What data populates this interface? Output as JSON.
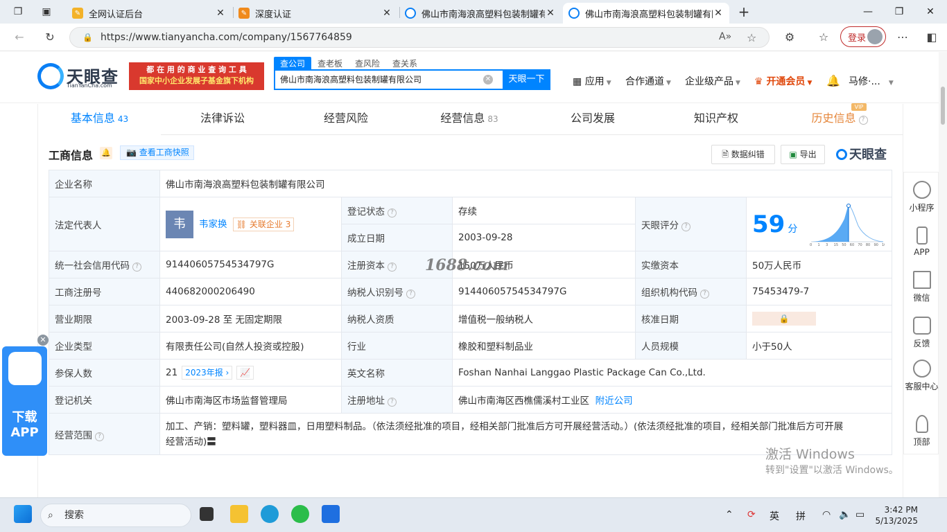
{
  "browser": {
    "tabs": [
      {
        "title": "全网认证后台",
        "active": false
      },
      {
        "title": "深度认证",
        "active": false
      },
      {
        "title": "佛山市南海浪高塑料包装制罐有限",
        "active": false
      },
      {
        "title": "佛山市南海浪高塑料包装制罐有限",
        "active": true
      }
    ],
    "url": "https://www.tianyancha.com/company/1567764859",
    "login_label": "登录"
  },
  "header": {
    "logo_text": "天眼查",
    "logo_sub": "TianYanCha.com",
    "ad_line1": "都 在 用 的 商 业 查 询 工 具",
    "ad_line2": "国家中小企业发展子基金旗下机构",
    "search_tabs": [
      "查公司",
      "查老板",
      "查风险",
      "查关系"
    ],
    "search_value": "佛山市南海浪高塑料包装制罐有限公司",
    "search_button": "天眼一下",
    "nav": [
      {
        "label": "应用"
      },
      {
        "label": "合作通道"
      },
      {
        "label": "企业级产品"
      },
      {
        "label": "开通会员"
      }
    ],
    "user_name": "马修·..."
  },
  "nav_tabs": [
    {
      "label": "基本信息",
      "count": "43"
    },
    {
      "label": "法律诉讼",
      "count": ""
    },
    {
      "label": "经营风险",
      "count": ""
    },
    {
      "label": "经营信息",
      "count": "83"
    },
    {
      "label": "公司发展",
      "count": ""
    },
    {
      "label": "知识产权",
      "count": ""
    },
    {
      "label": "历史信息",
      "count": "",
      "badge": "VIP"
    }
  ],
  "section": {
    "title": "工商信息",
    "snapshot_label": "查看工商快照",
    "correction_label": "数据纠错",
    "export_label": "导出",
    "brand": "天眼查"
  },
  "info": {
    "company_name_label": "企业名称",
    "company_name": "佛山市南海浪高塑料包装制罐有限公司",
    "legal_rep_label": "法定代表人",
    "legal_rep_avatar": "韦",
    "legal_rep": "韦家换",
    "related_label": "关联企业",
    "related_count": "3",
    "reg_status_label": "登记状态",
    "reg_status": "存续",
    "founded_label": "成立日期",
    "founded": "2003-09-28",
    "score_label": "天眼评分",
    "score": "59",
    "score_unit": "分",
    "score_axis": [
      "0",
      "1",
      "3",
      "15",
      "50",
      "60",
      "70",
      "80",
      "90",
      "100"
    ],
    "credit_code_label": "统一社会信用代码",
    "credit_code": "91440605754534797G",
    "reg_capital_label": "注册资本",
    "reg_capital": "150万人民币",
    "paid_capital_label": "实缴资本",
    "paid_capital": "50万人民币",
    "reg_no_label": "工商注册号",
    "reg_no": "440682000206490",
    "taxpayer_id_label": "纳税人识别号",
    "taxpayer_id": "91440605754534797G",
    "org_code_label": "组织机构代码",
    "org_code": "75453479-7",
    "term_label": "营业期限",
    "term": "2003-09-28 至 无固定期限",
    "taxpayer_qual_label": "纳税人资质",
    "taxpayer_qual": "增值税一般纳税人",
    "approval_date_label": "核准日期",
    "company_type_label": "企业类型",
    "company_type": "有限责任公司(自然人投资或控股)",
    "industry_label": "行业",
    "industry": "橡胶和塑料制品业",
    "staff_size_label": "人员规模",
    "staff_size": "小于50人",
    "insured_label": "参保人数",
    "insured": "21",
    "insured_year": "2023年报",
    "english_name_label": "英文名称",
    "english_name": "Foshan Nanhai Langgao Plastic Package Can Co.,Ltd.",
    "authority_label": "登记机关",
    "authority": "佛山市南海区市场监督管理局",
    "address_label": "注册地址",
    "address": "佛山市南海区西樵儒溪村工业区",
    "nearby_label": "附近公司",
    "scope_label": "经营范围",
    "scope_line1": "加工、产销：塑料罐，塑料器皿，日用塑料制品。（依法须经批准的项目，经相关部门批准后方可开展经营活动。）(依法须经批准的项目，经相关部门批准后方可开展",
    "scope_line2": "经营活动)"
  },
  "watermark": "1688.com",
  "right_sidebar": [
    {
      "label": "小程序",
      "icon": "mini-program-icon"
    },
    {
      "label": "APP",
      "icon": "phone-icon"
    },
    {
      "label": "微信",
      "icon": "qr-icon"
    },
    {
      "label": "反馈",
      "icon": "feedback-icon"
    },
    {
      "label": "客服中心",
      "icon": "support-icon"
    },
    {
      "label": "顶部",
      "icon": "rocket-icon"
    }
  ],
  "download_app": {
    "line1": "下载",
    "line2": "APP"
  },
  "activation": {
    "line1": "激活 Windows",
    "line2": "转到\"设置\"以激活 Windows。"
  },
  "taskbar": {
    "search_placeholder": "搜索",
    "ime1": "英",
    "ime2": "拼",
    "time": "3:42 PM",
    "date": "5/13/2025"
  },
  "colors": {
    "accent": "#0084ff",
    "vip": "#e0480c",
    "green": "#2f9a44"
  }
}
